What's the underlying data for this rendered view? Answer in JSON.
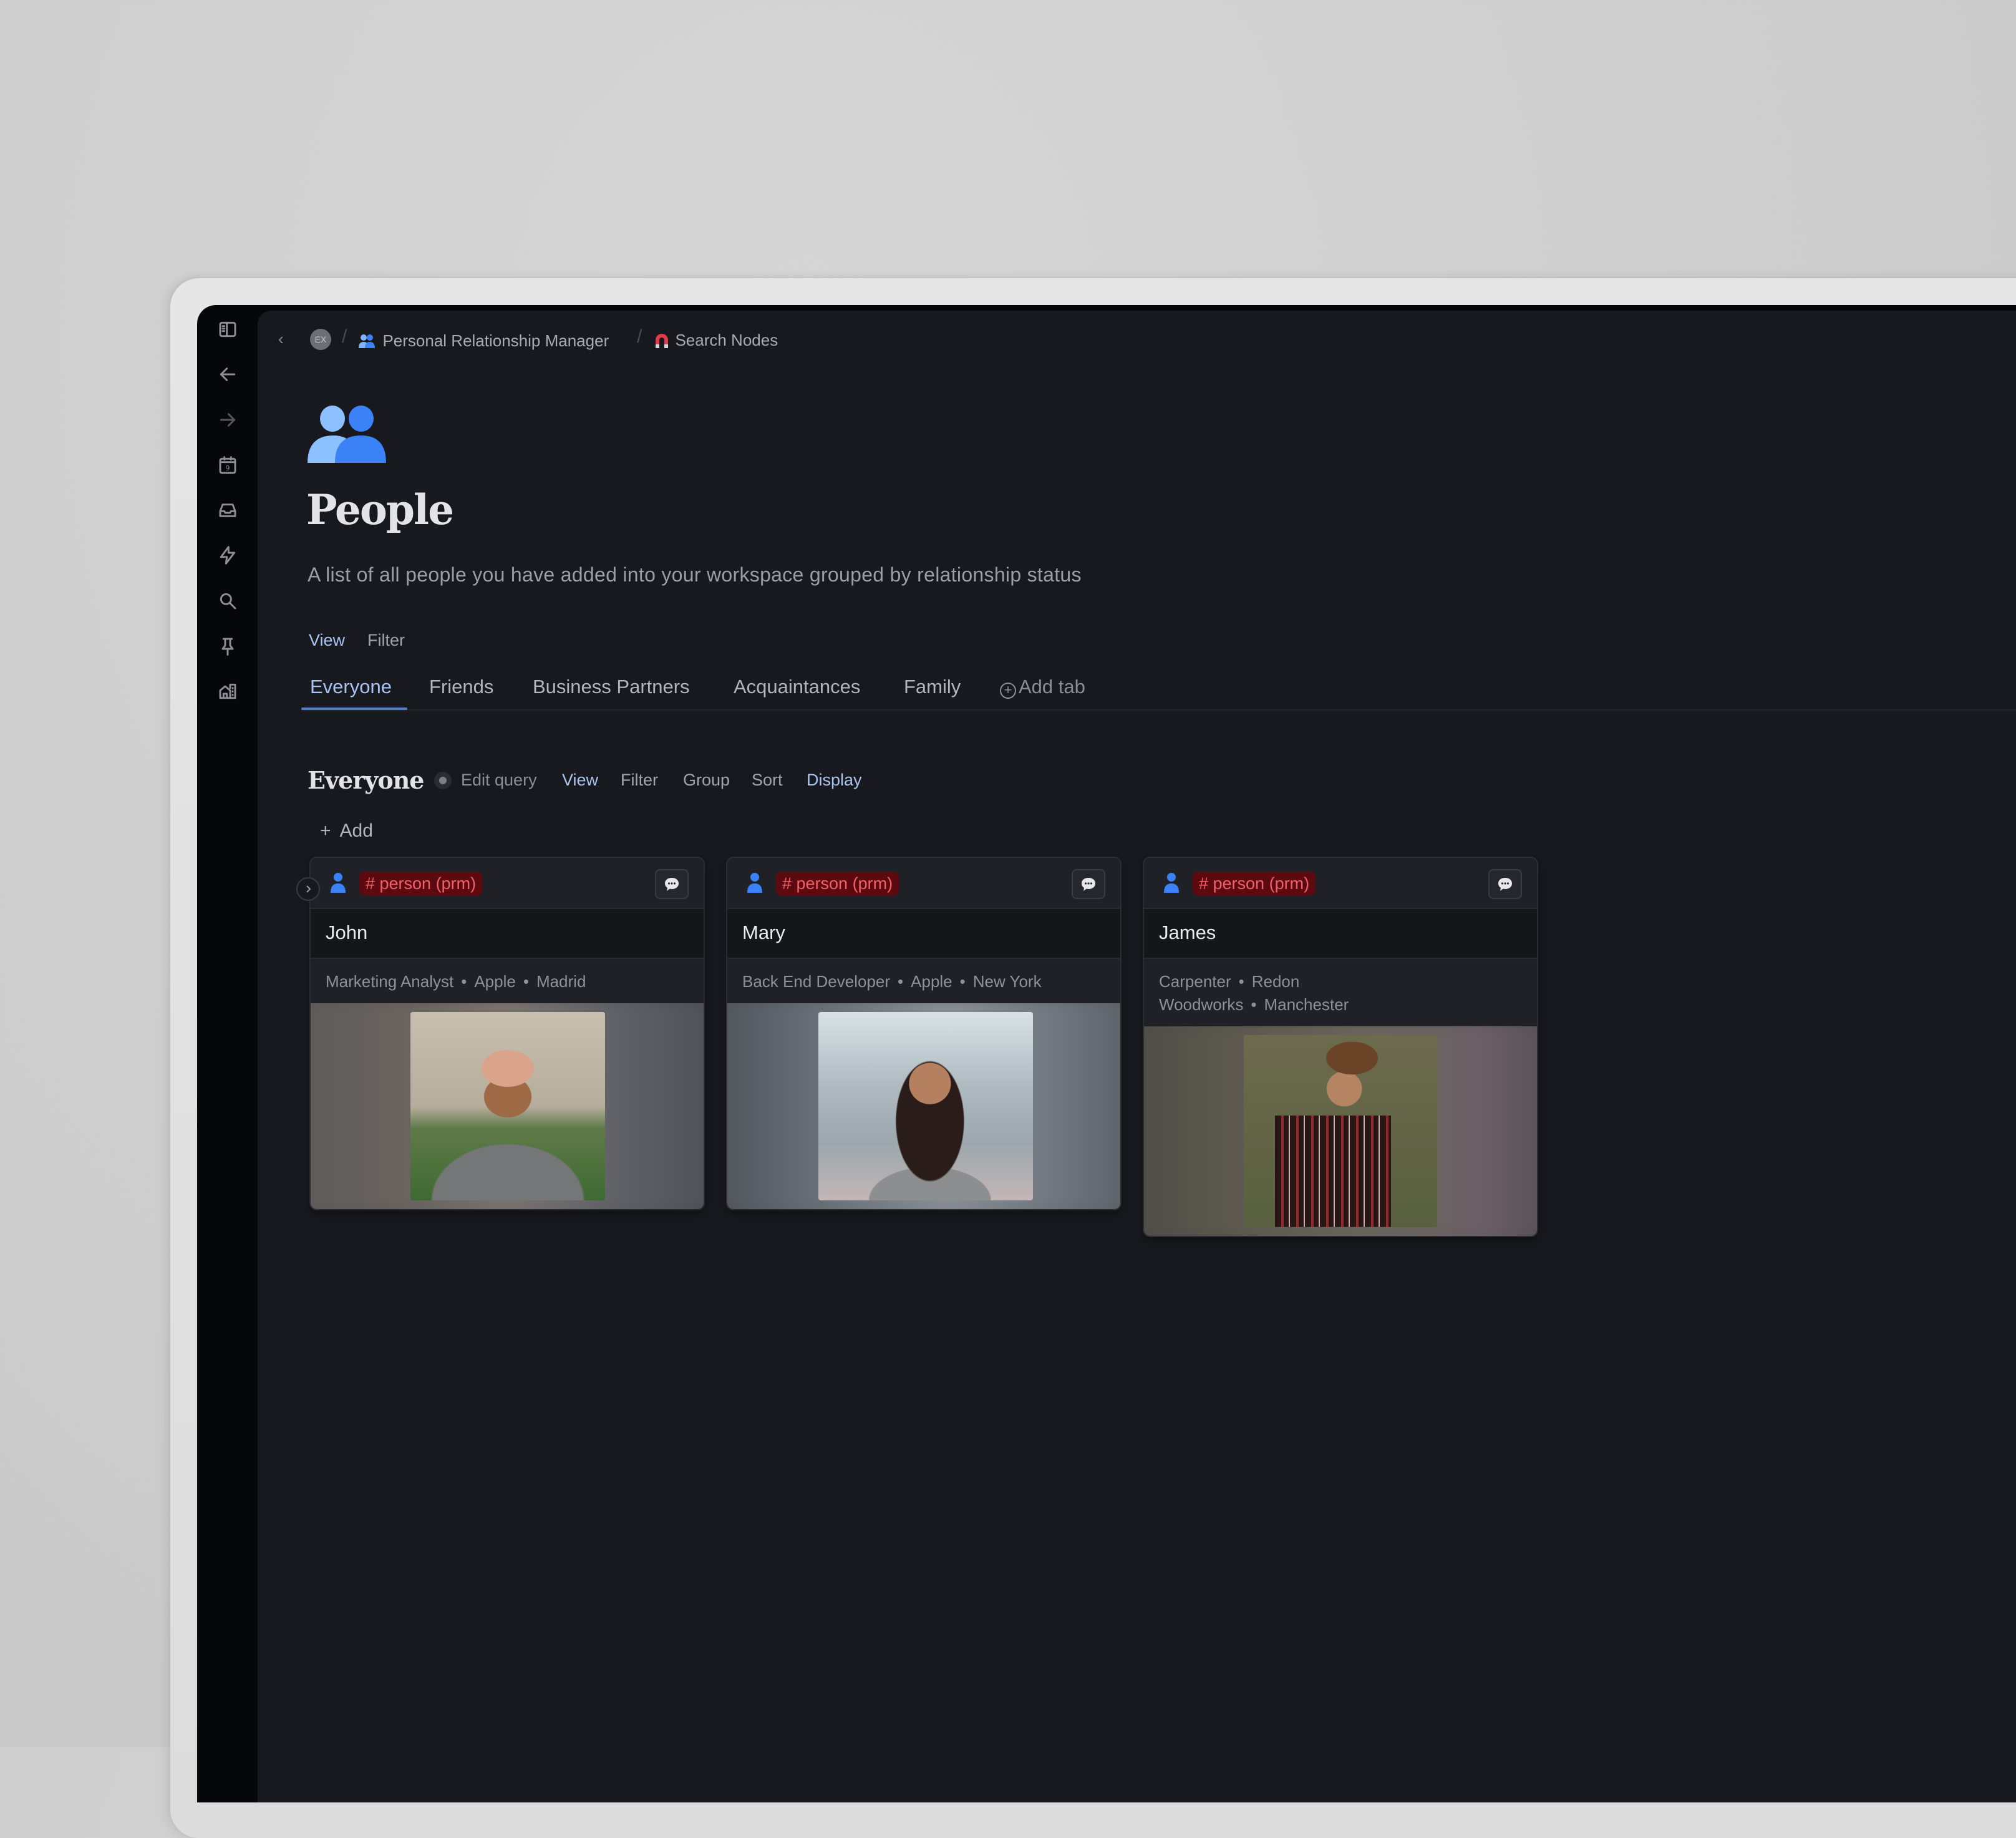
{
  "breadcrumb": {
    "avatar_initials": "EX",
    "items": [
      {
        "label": "Personal Relationship Manager",
        "icon": "people-icon"
      },
      {
        "label": "Search Nodes",
        "icon": "magnet-icon"
      }
    ]
  },
  "sidebar": {
    "items": [
      {
        "name": "toggle-sidebar",
        "icon": "sidebar-panel-icon"
      },
      {
        "name": "back",
        "icon": "arrow-left-icon"
      },
      {
        "name": "forward",
        "icon": "arrow-right-icon"
      },
      {
        "name": "calendar",
        "icon": "calendar-icon",
        "badge": "9"
      },
      {
        "name": "inbox",
        "icon": "inbox-icon"
      },
      {
        "name": "quick-actions",
        "icon": "lightning-icon"
      },
      {
        "name": "search",
        "icon": "search-icon"
      },
      {
        "name": "pinned",
        "icon": "pin-icon"
      },
      {
        "name": "workspace-home",
        "icon": "home-building-icon"
      }
    ]
  },
  "page": {
    "icon": "people-icon",
    "title": "People",
    "description": "A list of all people you have added into your workspace grouped by relationship status",
    "view_label": "View",
    "filter_label": "Filter"
  },
  "tabs": [
    {
      "label": "Everyone",
      "active": true
    },
    {
      "label": "Friends",
      "active": false
    },
    {
      "label": "Business Partners",
      "active": false
    },
    {
      "label": "Acquaintances",
      "active": false
    },
    {
      "label": "Family",
      "active": false
    }
  ],
  "add_tab_label": "Add tab",
  "section": {
    "title": "Everyone",
    "edit_query": "Edit query",
    "toolbar": [
      "View",
      "Filter",
      "Group",
      "Sort",
      "Display"
    ],
    "add_label": "Add"
  },
  "colors": {
    "accent_blue": "#a8c4f0",
    "tag_bg": "#5c0a10",
    "tag_text": "#f0606a",
    "person_icon": "#3b82f6"
  },
  "cards": [
    {
      "tag": "# person (prm)",
      "name": "John",
      "meta": [
        "Marketing Analyst",
        "Apple",
        "Madrid"
      ],
      "photo": "bearded man in grey t-shirt outdoors"
    },
    {
      "tag": "# person (prm)",
      "name": "Mary",
      "meta": [
        "Back End Developer",
        "Apple",
        "New York"
      ],
      "photo": "smiling woman with glasses on city street"
    },
    {
      "tag": "# person (prm)",
      "name": "James",
      "meta": [
        "Carpenter",
        "Redon Woodworks",
        "Manchester"
      ],
      "photo": "man in beanie and plaid shirt in forest"
    }
  ]
}
